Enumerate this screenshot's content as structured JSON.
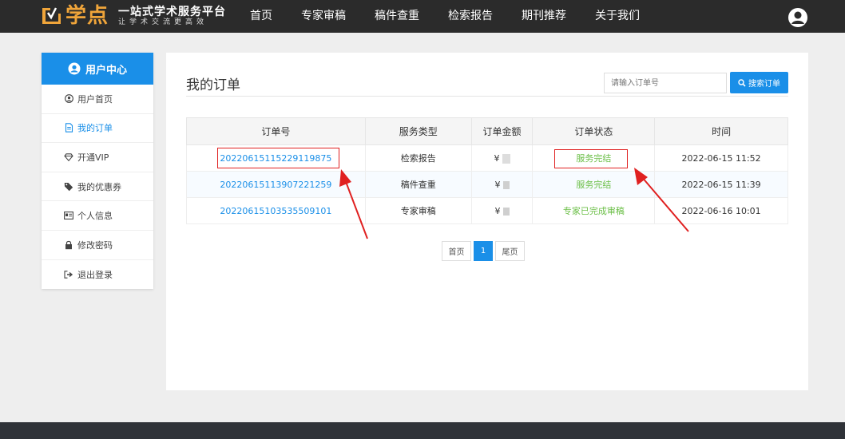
{
  "header": {
    "brand_name": "学点",
    "slogan": "一站式学术服务平台",
    "slogan_sub": "让学术交流更高效",
    "nav": [
      "首页",
      "专家审稿",
      "稿件查重",
      "检索报告",
      "期刊推荐",
      "关于我们"
    ]
  },
  "sidebar": {
    "title": "用户中心",
    "items": [
      {
        "label": "用户首页",
        "icon": "user-circle-icon"
      },
      {
        "label": "我的订单",
        "icon": "document-icon",
        "active": true
      },
      {
        "label": "开通VIP",
        "icon": "diamond-icon"
      },
      {
        "label": "我的优惠券",
        "icon": "tag-icon"
      },
      {
        "label": "个人信息",
        "icon": "id-card-icon"
      },
      {
        "label": "修改密码",
        "icon": "lock-icon"
      },
      {
        "label": "退出登录",
        "icon": "sign-out-icon"
      }
    ]
  },
  "main": {
    "title": "我的订单",
    "search": {
      "placeholder": "请输入订单号",
      "button_label": "搜索订单"
    },
    "table": {
      "headers": [
        "订单号",
        "服务类型",
        "订单金额",
        "订单状态",
        "时间"
      ],
      "rows": [
        {
          "order_no": "2022061511522911987​5",
          "service": "检索报告",
          "amount": "¥",
          "status": "服务完结",
          "time": "2022-06-15 11:52"
        },
        {
          "order_no": "20220615113907221259",
          "service": "稿件查重",
          "amount": "¥",
          "status": "服务完结",
          "time": "2022-06-15 11:39"
        },
        {
          "order_no": "20220615103535509101",
          "service": "专家审稿",
          "amount": "¥",
          "status": "专家已完成审稿",
          "time": "2022-06-16 10:01"
        }
      ]
    },
    "pager": {
      "first": "首页",
      "current": "1",
      "last": "尾页"
    }
  },
  "colors": {
    "accent": "#1a8fe8",
    "status": "#6bbf47",
    "annotation": "#e02020",
    "brand": "#f0a53a"
  }
}
